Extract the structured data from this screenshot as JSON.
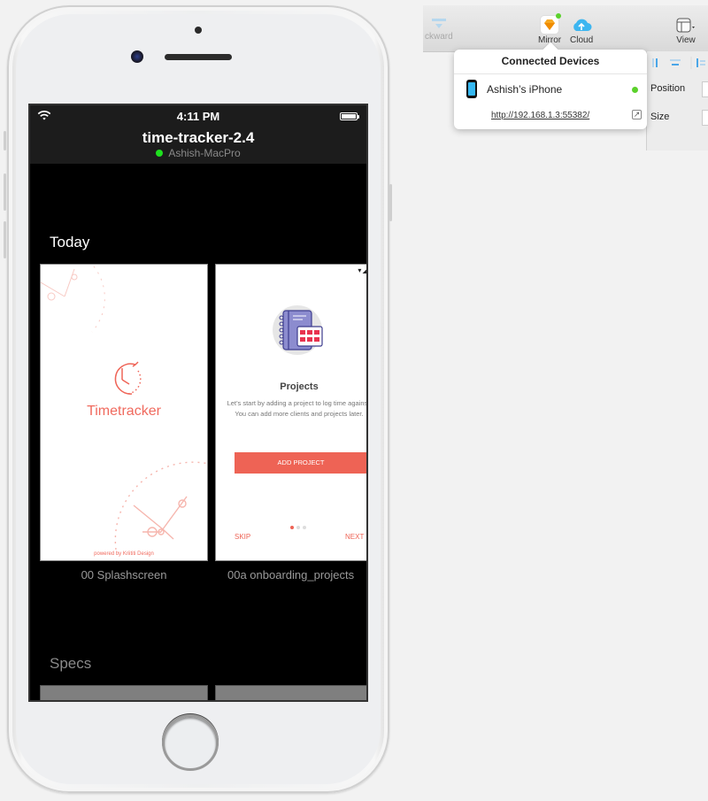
{
  "toolbar": {
    "items": [
      {
        "label": "ckward",
        "icon": "backward-icon"
      },
      {
        "label": "Mirror",
        "icon": "sketch-mirror-icon"
      },
      {
        "label": "Cloud",
        "icon": "cloud-upload-icon"
      },
      {
        "label": "View",
        "icon": "view-layout-icon"
      }
    ]
  },
  "inspector": {
    "position_label": "Position",
    "size_label": "Size"
  },
  "popover": {
    "title": "Connected Devices",
    "device_name": "Ashish’s iPhone",
    "device_status_color": "#5bd12b",
    "url": "http://192.168.1.3:55382/"
  },
  "phone": {
    "status": {
      "time": "4:11 PM"
    },
    "document_title": "time-tracker-2.4",
    "host_name": "Ashish-MacPro",
    "host_status_color": "#1ee01e",
    "sections": [
      {
        "title": "Today",
        "artboards": [
          {
            "label": "00 Splashscreen",
            "app_name": "Timetracker",
            "powered_by": "powered by Kriititi Design"
          },
          {
            "label": "00a onboarding_projects",
            "heading": "Projects",
            "body": "Let’s start by adding a project to log time against. You can add more clients and projects later.",
            "button": "ADD PROJECT",
            "skip": "SKIP",
            "next": "NEXT",
            "page_index": 1,
            "page_count": 3
          }
        ]
      },
      {
        "title": "Specs"
      }
    ]
  },
  "colors": {
    "accent": "#ee6355",
    "screen_bg": "#000000",
    "statusbar_bg": "#1c1c1c"
  }
}
